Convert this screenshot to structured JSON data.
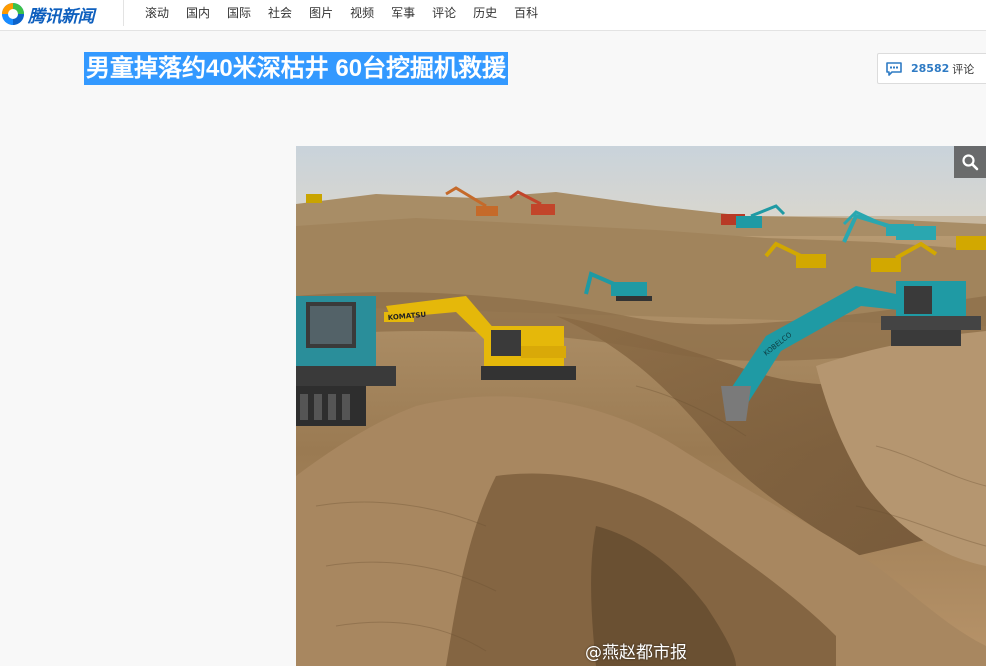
{
  "brand": {
    "name": "腾讯新闻",
    "icon": "tencent-logo-icon"
  },
  "nav": {
    "items": [
      {
        "label": "滚动"
      },
      {
        "label": "国内"
      },
      {
        "label": "国际"
      },
      {
        "label": "社会"
      },
      {
        "label": "图片"
      },
      {
        "label": "视频"
      },
      {
        "label": "军事"
      },
      {
        "label": "评论"
      },
      {
        "label": "历史"
      },
      {
        "label": "百科"
      }
    ]
  },
  "article": {
    "title": "男童掉落约40米深枯井 60台挖掘机救援"
  },
  "comments": {
    "count": "28582",
    "label": "评论",
    "icon": "comment-bubble-icon",
    "color": "#2f7bc4"
  },
  "photo": {
    "watermark": "@燕赵都市报",
    "zoom_icon": "magnifier-icon",
    "description_icon": "excavation-site-photo"
  },
  "colors": {
    "selection": "#3399ff",
    "link": "#2f7bc4",
    "brand": "#0e5fbe"
  }
}
